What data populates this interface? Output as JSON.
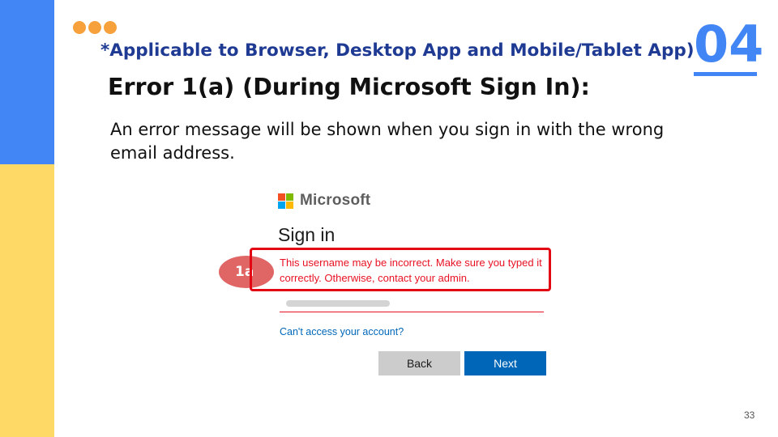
{
  "slide": {
    "subtitle": "*Applicable to Browser, Desktop App and Mobile/Tablet App)",
    "section_number": "04",
    "title": "Error 1(a) (During Microsoft Sign In):",
    "body": "An error message will be shown when you sign in with the wrong email address.",
    "page_number": "33",
    "accent_color": "#4285f4",
    "secondary_color": "#ffd966",
    "dot_color": "#f6a13c"
  },
  "signin": {
    "brand": "Microsoft",
    "heading": "Sign in",
    "error_message": "This username may be incorrect. Make sure you typed it correctly. Otherwise, contact your admin.",
    "cant_access_link": "Can't access your account?",
    "back_label": "Back",
    "next_label": "Next",
    "logo_colors": [
      "#f25022",
      "#7fba00",
      "#00a4ef",
      "#ffb900"
    ]
  },
  "annotation": {
    "label": "1a",
    "color": "#e06666",
    "box_color": "#e30613"
  }
}
